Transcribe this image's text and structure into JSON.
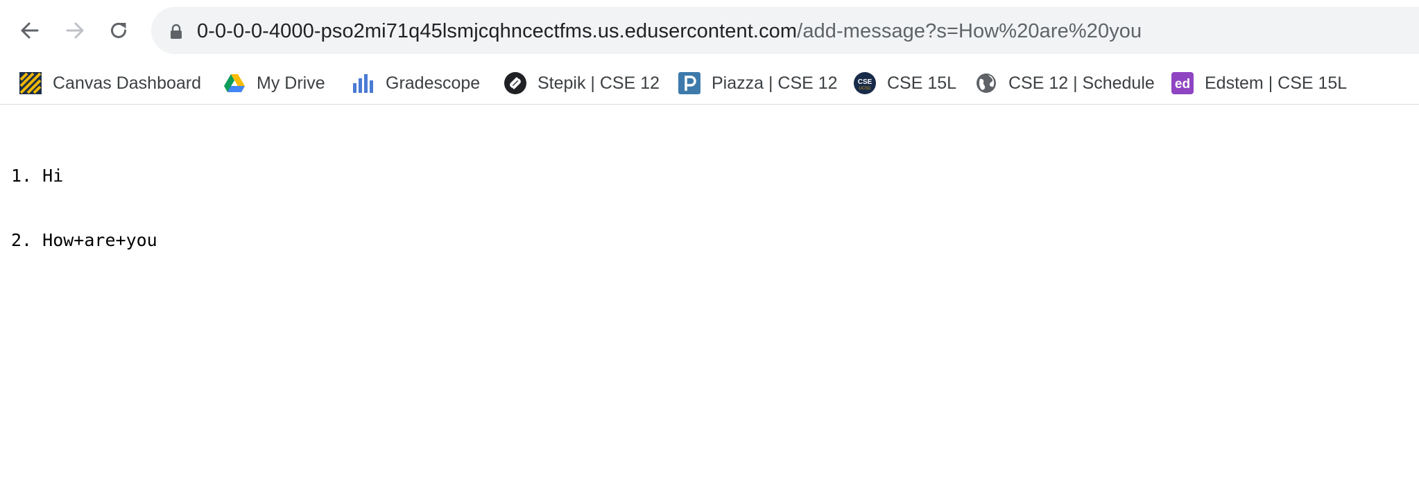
{
  "browser": {
    "url_host": "0-0-0-0-4000-pso2mi71q45lsmjcqhncectfms.us.edusercontent.com",
    "url_path": "/add-message?s=How%20are%20you"
  },
  "bookmarks": [
    {
      "label": "Canvas Dashboard",
      "icon": "canvas-icon"
    },
    {
      "label": "My Drive",
      "icon": "google-drive-icon"
    },
    {
      "label": "Gradescope",
      "icon": "gradescope-icon"
    },
    {
      "label": "Stepik | CSE 12",
      "icon": "stepik-icon"
    },
    {
      "label": "Piazza | CSE 12",
      "icon": "piazza-icon"
    },
    {
      "label": "CSE 15L",
      "icon": "cse-ucsd-icon",
      "icon_text_top": "CSE",
      "icon_text_bottom": "UCSD"
    },
    {
      "label": "CSE 12 | Schedule",
      "icon": "globe-icon"
    },
    {
      "label": "Edstem | CSE 15L",
      "icon": "edstem-icon",
      "icon_text": "ed"
    }
  ],
  "page": {
    "lines": [
      "1. Hi",
      "2. How+are+you"
    ]
  }
}
